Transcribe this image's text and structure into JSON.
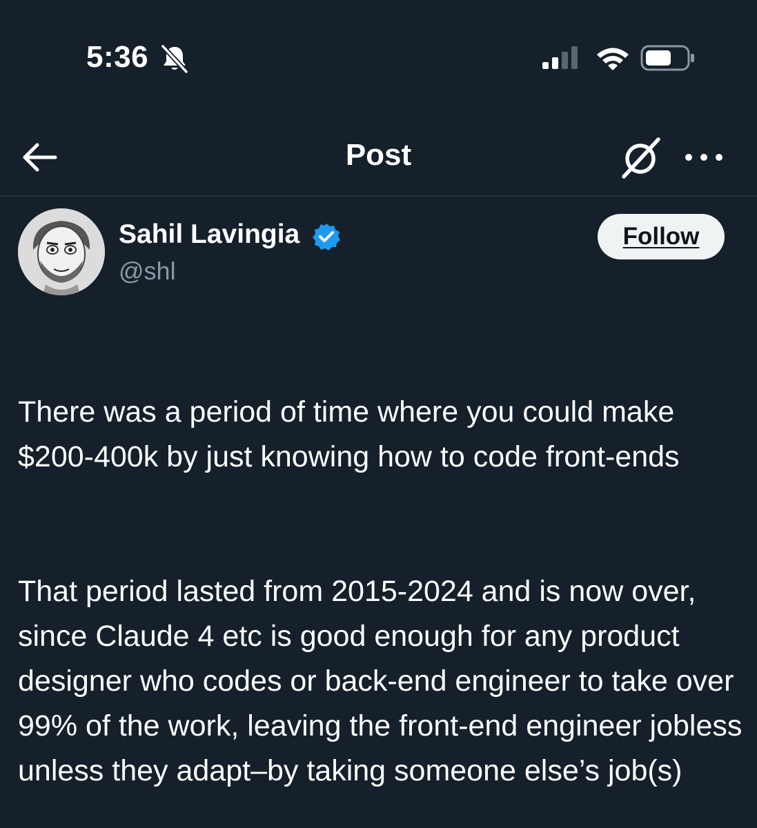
{
  "status_bar": {
    "time": "5:36",
    "icons": [
      "bell-slash-icon",
      "cellular-signal-icon",
      "wifi-icon",
      "battery-icon"
    ]
  },
  "header": {
    "title": "Post",
    "back_icon": "arrow-left-icon",
    "grok_icon": "grok-icon",
    "more_icon": "more-horizontal-icon"
  },
  "author": {
    "name": "Sahil Lavingia",
    "handle": "@shl",
    "verified": true,
    "follow_label": "Follow"
  },
  "post": {
    "paragraphs": [
      "There was a period of time where you could make $200-400k by just knowing how to code front-ends",
      "That period lasted from 2015-2024 and is now over, since Claude 4 etc is good enough for any product designer who codes or back-end engineer to take over 99% of the work, leaving the front-end engineer jobless unless they adapt–by taking someone else’s job(s)"
    ]
  },
  "colors": {
    "background": "#15202b",
    "text": "#ffffff",
    "secondary_text": "#8b98a5",
    "verified_blue": "#1d9bf0",
    "follow_bg": "#eff3f4",
    "divider": "#263340"
  }
}
